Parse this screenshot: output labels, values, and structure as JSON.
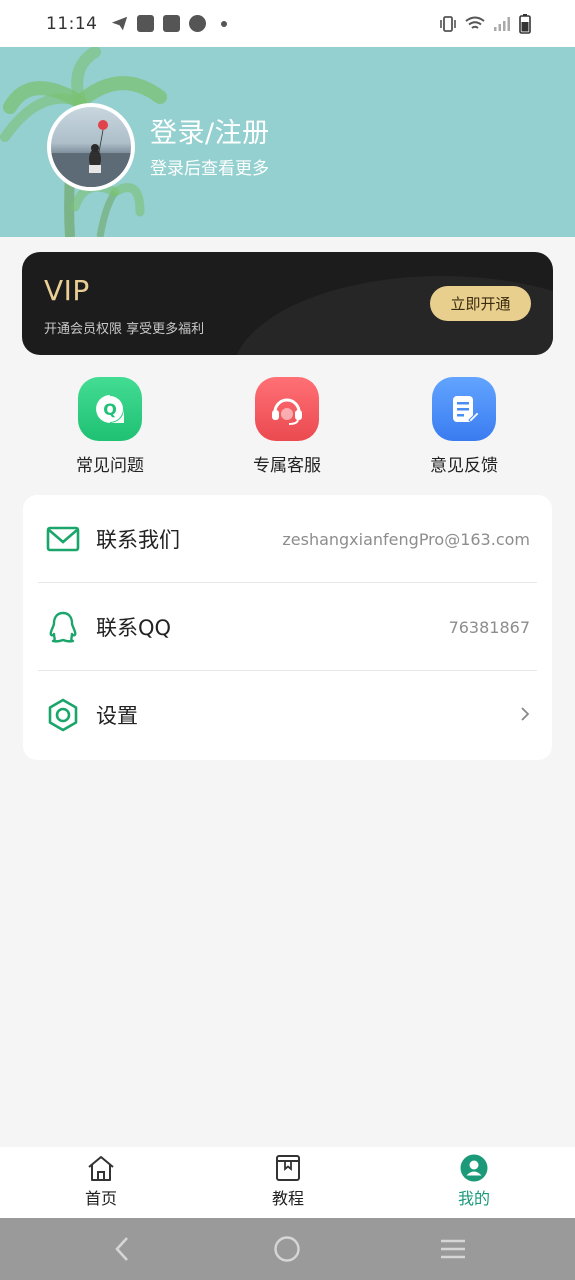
{
  "status_bar": {
    "time": "11:14",
    "left_icons": [
      "send-icon",
      "mail-icon",
      "mail-icon",
      "speedometer-icon",
      "dot-icon"
    ],
    "right_icons": [
      "vibrate-icon",
      "wifi-icon",
      "signal-icon",
      "battery-icon"
    ]
  },
  "header": {
    "title": "登录/注册",
    "subtitle": "登录后查看更多",
    "background_color": "#93d0cf"
  },
  "vip": {
    "title": "VIP",
    "subtitle": "开通会员权限 享受更多福利",
    "button_label": "立即开通",
    "accent_color": "#e8cf8d"
  },
  "quick_actions": [
    {
      "label": "常见问题",
      "icon": "faq-icon",
      "color": "#2fcf83"
    },
    {
      "label": "专属客服",
      "icon": "headset-icon",
      "color": "#f2575d"
    },
    {
      "label": "意见反馈",
      "icon": "feedback-icon",
      "color": "#4a8ef5"
    }
  ],
  "contact": {
    "rows": [
      {
        "label": "联系我们",
        "value": "zeshangxianfengPro@163.com",
        "icon": "mail-icon"
      },
      {
        "label": "联系QQ",
        "value": "76381867",
        "icon": "qq-icon"
      },
      {
        "label": "设置",
        "value": "",
        "icon": "settings-icon"
      }
    ]
  },
  "bottom_nav": {
    "items": [
      {
        "label": "首页",
        "icon": "home-icon",
        "active": false
      },
      {
        "label": "教程",
        "icon": "book-icon",
        "active": false
      },
      {
        "label": "我的",
        "icon": "user-icon",
        "active": true
      }
    ],
    "active_color": "#1b9a7a"
  },
  "system_nav": {
    "buttons": [
      "back-icon",
      "home-circle-icon",
      "menu-icon"
    ]
  }
}
